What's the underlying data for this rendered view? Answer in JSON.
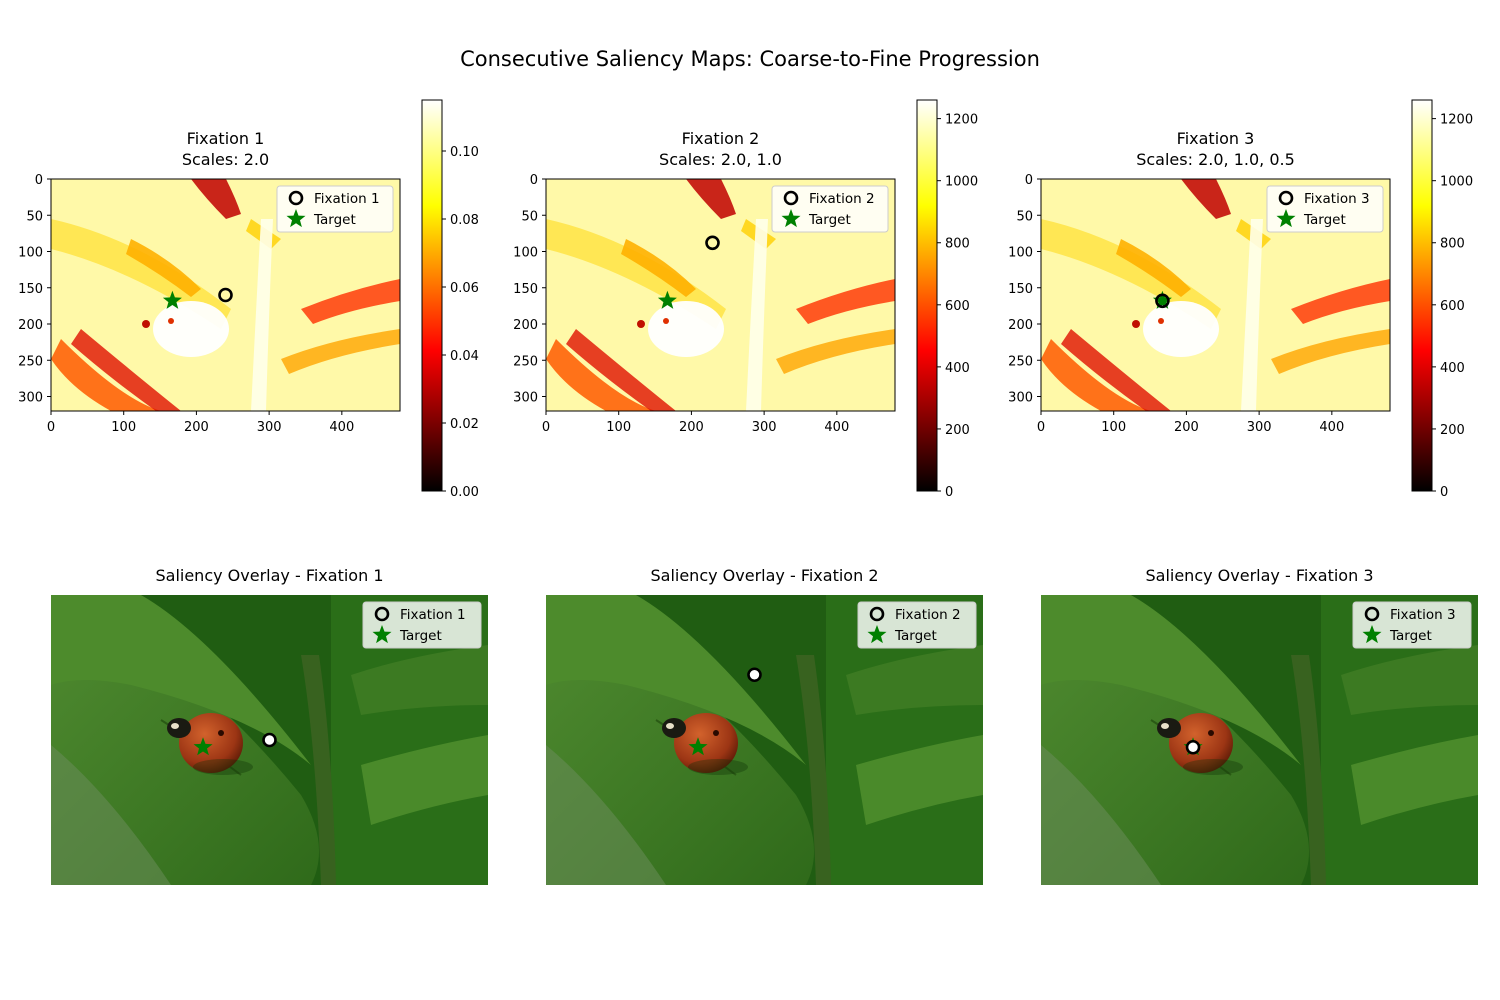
{
  "figure": {
    "title": "Consecutive Saliency Maps: Coarse-to-Fine Progression"
  },
  "chart_data": [
    {
      "type": "heatmap",
      "panel": "saliency-map-1",
      "title_line1": "Fixation 1",
      "title_line2": "Scales: 2.0",
      "xlim": [
        0,
        480
      ],
      "ylim": [
        320,
        0
      ],
      "xticks": [
        "0",
        "100",
        "200",
        "300",
        "400"
      ],
      "yticks": [
        "0",
        "50",
        "100",
        "150",
        "200",
        "250",
        "300"
      ],
      "colormap": "hot",
      "colorbar": {
        "range": [
          0.0,
          0.115
        ],
        "ticks": [
          "0.00",
          "0.02",
          "0.04",
          "0.06",
          "0.08",
          "0.10"
        ]
      },
      "fixation": {
        "label": "Fixation 1",
        "x": 240,
        "y": 160
      },
      "target": {
        "label": "Target",
        "x": 167,
        "y": 168
      },
      "legend_placement": "upper right"
    },
    {
      "type": "heatmap",
      "panel": "saliency-map-2",
      "title_line1": "Fixation 2",
      "title_line2": "Scales: 2.0, 1.0",
      "xlim": [
        0,
        480
      ],
      "ylim": [
        320,
        0
      ],
      "xticks": [
        "0",
        "100",
        "200",
        "300",
        "400"
      ],
      "yticks": [
        "0",
        "50",
        "100",
        "150",
        "200",
        "250",
        "300"
      ],
      "colormap": "hot",
      "colorbar": {
        "range": [
          0,
          1260
        ],
        "ticks": [
          "0",
          "200",
          "400",
          "600",
          "800",
          "1000",
          "1200"
        ]
      },
      "fixation": {
        "label": "Fixation 2",
        "x": 229,
        "y": 88
      },
      "target": {
        "label": "Target",
        "x": 167,
        "y": 168
      },
      "legend_placement": "upper right"
    },
    {
      "type": "heatmap",
      "panel": "saliency-map-3",
      "title_line1": "Fixation 3",
      "title_line2": "Scales: 2.0, 1.0, 0.5",
      "xlim": [
        0,
        480
      ],
      "ylim": [
        320,
        0
      ],
      "xticks": [
        "0",
        "100",
        "200",
        "300",
        "400"
      ],
      "yticks": [
        "0",
        "50",
        "100",
        "150",
        "200",
        "250",
        "300"
      ],
      "colormap": "hot",
      "colorbar": {
        "range": [
          0,
          1260
        ],
        "ticks": [
          "0",
          "200",
          "400",
          "600",
          "800",
          "1000",
          "1200"
        ]
      },
      "fixation": {
        "label": "Fixation 3",
        "x": 167,
        "y": 168
      },
      "target": {
        "label": "Target",
        "x": 167,
        "y": 168
      },
      "legend_placement": "upper right"
    },
    {
      "type": "scatter",
      "panel": "overlay-1",
      "title": "Saliency Overlay - Fixation 1",
      "xlim": [
        0,
        480
      ],
      "ylim": [
        320,
        0
      ],
      "fixation": {
        "label": "Fixation 1",
        "x": 240,
        "y": 160
      },
      "target": {
        "label": "Target",
        "x": 167,
        "y": 168
      },
      "legend_placement": "upper right"
    },
    {
      "type": "scatter",
      "panel": "overlay-2",
      "title": "Saliency Overlay - Fixation 2",
      "xlim": [
        0,
        480
      ],
      "ylim": [
        320,
        0
      ],
      "fixation": {
        "label": "Fixation 2",
        "x": 229,
        "y": 88
      },
      "target": {
        "label": "Target",
        "x": 167,
        "y": 168
      },
      "legend_placement": "upper right"
    },
    {
      "type": "scatter",
      "panel": "overlay-3",
      "title": "Saliency Overlay - Fixation 3",
      "xlim": [
        0,
        480
      ],
      "ylim": [
        320,
        0
      ],
      "fixation": {
        "label": "Fixation 3",
        "x": 167,
        "y": 168
      },
      "target": {
        "label": "Target",
        "x": 167,
        "y": 168
      },
      "legend_placement": "upper right"
    }
  ],
  "colors": {
    "target": "#008000",
    "fixation_edge": "#000000",
    "fixation_face": "#ffffff",
    "photo_leaf": "#3f7a26",
    "photo_bg": "#1f5a10",
    "ladybug": "#a8401a"
  }
}
